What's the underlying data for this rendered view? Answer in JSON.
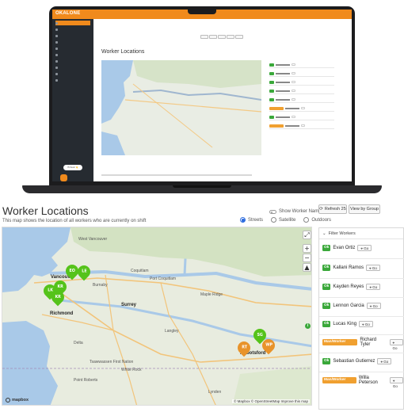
{
  "laptop": {
    "brand": "OKALONE",
    "screen_title": "Worker Locations",
    "chat_label": "Hi there! 👋"
  },
  "header": {
    "title": "Worker Locations",
    "subtitle": "This map shows the location of all workers who are currently on shift",
    "show_names_label": "Show Worker Names",
    "map_styles": [
      {
        "label": "Streets",
        "selected": true
      },
      {
        "label": "Satellite",
        "selected": false
      },
      {
        "label": "Outdoors",
        "selected": false
      }
    ],
    "refresh_label": "Refresh 25",
    "view_group_label": "View by Group"
  },
  "map": {
    "cities": [
      {
        "name": "Vancouver"
      },
      {
        "name": "Burnaby"
      },
      {
        "name": "Richmond"
      },
      {
        "name": "Surrey"
      },
      {
        "name": "Coquitlam"
      },
      {
        "name": "Port Coquitlam"
      },
      {
        "name": "Maple Ridge"
      },
      {
        "name": "Delta"
      },
      {
        "name": "Langley"
      },
      {
        "name": "Abbotsford"
      },
      {
        "name": "Lynden"
      },
      {
        "name": "Point Roberts"
      },
      {
        "name": "Tsawwassen First Nation"
      },
      {
        "name": "White Rock"
      }
    ],
    "pins": [
      {
        "label": "EO",
        "color": "green"
      },
      {
        "label": "LE",
        "color": "green"
      },
      {
        "label": "KR",
        "color": "green"
      },
      {
        "label": "LK",
        "color": "green"
      },
      {
        "label": "KR",
        "color": "green"
      },
      {
        "label": "SG",
        "color": "green"
      },
      {
        "label": "RT",
        "color": "orange"
      },
      {
        "label": "WP",
        "color": "orange"
      }
    ],
    "attribution": "© Mapbox © OpenStreetMap Improve this map",
    "logo": "mapbox"
  },
  "panel": {
    "header": "Filter Workers",
    "workers": [
      {
        "status": "Ok",
        "name": "Evan Ortiz",
        "go": "Go"
      },
      {
        "status": "Ok",
        "name": "Kallani Ramos",
        "go": "Go"
      },
      {
        "status": "Ok",
        "name": "Kayden Reyes",
        "go": "Go"
      },
      {
        "status": "Ok",
        "name": "Lennon Garcia",
        "go": "Go"
      },
      {
        "status": "Ok",
        "name": "Lucas King",
        "go": "Go"
      },
      {
        "status": "Man/Worker Down",
        "name": "Richard Tyler",
        "go": "Go"
      },
      {
        "status": "Ok",
        "name": "Sebastian Gutierrez",
        "go": "Go"
      },
      {
        "status": "Man/Worker Down",
        "name": "Willa Peterson",
        "go": "Go"
      }
    ]
  },
  "colors": {
    "brand_orange": "#f08a1c",
    "ok_green": "#3aa83a",
    "alert_orange": "#f0a030",
    "pin_green": "#55c31a"
  }
}
